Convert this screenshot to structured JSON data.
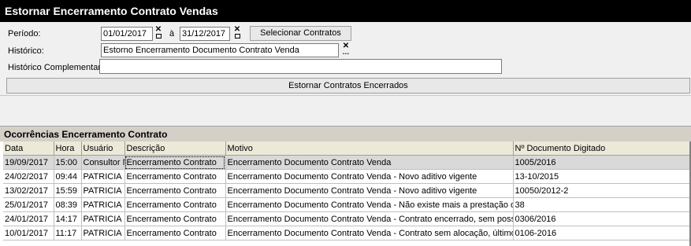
{
  "window": {
    "title": "Estornar Encerramento Contrato Vendas"
  },
  "form": {
    "periodo_label": "Período:",
    "date_start": "01/01/2017",
    "date_sep": "à",
    "date_end": "31/12/2017",
    "select_contracts_label": "Selecionar Contratos",
    "historico_label": "Histórico:",
    "historico_value": "Estorno Encerramento Documento Contrato Venda",
    "historico_comp_label": "Histórico Complementar:",
    "historico_comp_value": "",
    "estornar_label": "Estornar Contratos Encerrados"
  },
  "grid": {
    "title": "Ocorrências Encerramento Contrato",
    "columns": [
      "Data",
      "Hora",
      "Usuário",
      "Descrição",
      "Motivo",
      "Nº Documento Digitado"
    ],
    "rows": [
      [
        "19/09/2017",
        "15:00",
        "Consultor N",
        "Encerramento Contrato",
        "Encerramento Documento Contrato Venda",
        "1005/2016"
      ],
      [
        "24/02/2017",
        "09:44",
        "PATRICIA",
        "Encerramento Contrato",
        "Encerramento Documento Contrato Venda - Novo aditivo vigente",
        "13-10/2015"
      ],
      [
        "13/02/2017",
        "15:59",
        "PATRICIA",
        "Encerramento Contrato",
        "Encerramento Documento Contrato Venda - Novo aditivo vigente",
        "10050/2012-2"
      ],
      [
        "25/01/2017",
        "08:39",
        "PATRICIA",
        "Encerramento Contrato",
        "Encerramento Documento Contrato Venda - Não existe mais a prestação de",
        "38"
      ],
      [
        "24/01/2017",
        "14:17",
        "PATRICIA",
        "Encerramento Contrato",
        "Encerramento Documento Contrato Venda - Contrato encerrado, sem possibi",
        "0306/2016"
      ],
      [
        "10/01/2017",
        "11:17",
        "PATRICIA",
        "Encerramento Contrato",
        "Encerramento Documento Contrato Venda - Contrato sem alocação, último fa",
        "0106-2016"
      ]
    ]
  }
}
